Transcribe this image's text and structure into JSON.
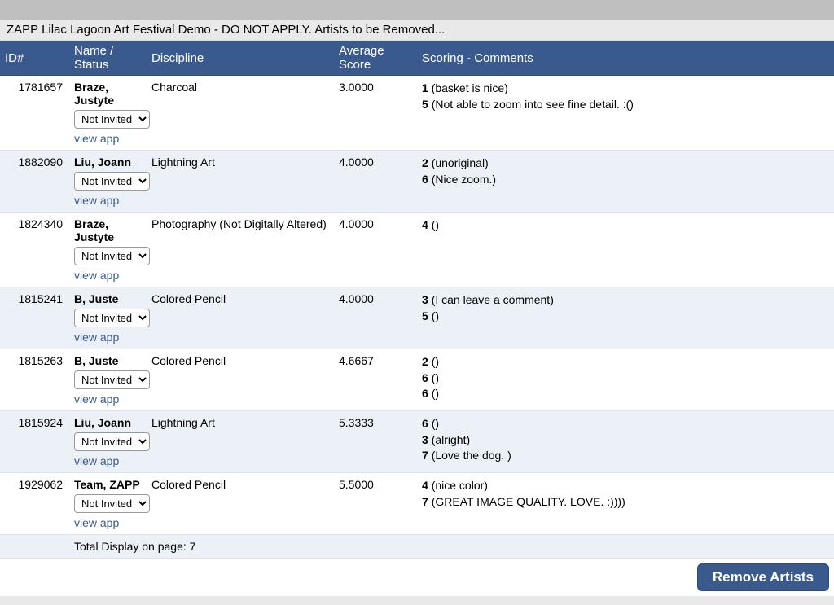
{
  "title": "ZAPP Lilac Lagoon Art Festival Demo - DO NOT APPLY. Artists to be Removed...",
  "columns": {
    "id": "ID#",
    "name": "Name / Status",
    "discipline": "Discipline",
    "avg": "Average Score",
    "scoring": "Scoring - Comments"
  },
  "status_option": "Not Invited",
  "view_app_label": "view app",
  "rows": [
    {
      "id": "1781657",
      "name": "Braze, Justyte",
      "discipline": "Charcoal",
      "avg": "3.0000",
      "comments": [
        {
          "s": "1",
          "c": "(basket is nice)"
        },
        {
          "s": "5",
          "c": "(Not able to zoom into see fine detail. :()"
        }
      ]
    },
    {
      "id": "1882090",
      "name": "Liu, Joann",
      "discipline": "Lightning Art",
      "avg": "4.0000",
      "comments": [
        {
          "s": "2",
          "c": "(unoriginal)"
        },
        {
          "s": "6",
          "c": "(Nice zoom.)"
        }
      ]
    },
    {
      "id": "1824340",
      "name": "Braze, Justyte",
      "discipline": "Photography (Not Digitally Altered)",
      "avg": "4.0000",
      "comments": [
        {
          "s": "4",
          "c": "()"
        }
      ]
    },
    {
      "id": "1815241",
      "name": "B, Juste",
      "discipline": "Colored Pencil",
      "avg": "4.0000",
      "comments": [
        {
          "s": "3",
          "c": "(I can leave a comment)"
        },
        {
          "s": "5",
          "c": "()"
        }
      ]
    },
    {
      "id": "1815263",
      "name": "B, Juste",
      "discipline": "Colored Pencil",
      "avg": "4.6667",
      "comments": [
        {
          "s": "2",
          "c": "()"
        },
        {
          "s": "6",
          "c": "()"
        },
        {
          "s": "6",
          "c": "()"
        }
      ]
    },
    {
      "id": "1815924",
      "name": "Liu, Joann",
      "discipline": "Lightning Art",
      "avg": "5.3333",
      "comments": [
        {
          "s": "6",
          "c": "()"
        },
        {
          "s": "3",
          "c": "(alright)"
        },
        {
          "s": "7",
          "c": "(Love the dog. )"
        }
      ]
    },
    {
      "id": "1929062",
      "name": "Team, ZAPP",
      "discipline": "Colored Pencil",
      "avg": "5.5000",
      "comments": [
        {
          "s": "4",
          "c": "(nice color)"
        },
        {
          "s": "7",
          "c": "(GREAT IMAGE QUALITY. LOVE. :))))"
        }
      ]
    }
  ],
  "total_label": "Total Display on page: 7",
  "remove_button": "Remove Artists"
}
